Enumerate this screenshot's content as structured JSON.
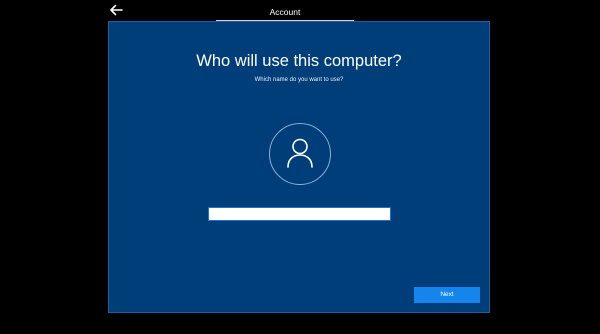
{
  "header": {
    "back_icon": "back-arrow-icon",
    "step_label": "Account"
  },
  "panel": {
    "title": "Who will use this computer?",
    "subtitle": "Which name do you want to use?",
    "avatar_icon": "user-icon",
    "name_input": {
      "value": "",
      "placeholder": ""
    },
    "next_label": "Next"
  },
  "colors": {
    "background": "#000000",
    "panel": "#003e7a",
    "accent": "#1585ee"
  }
}
